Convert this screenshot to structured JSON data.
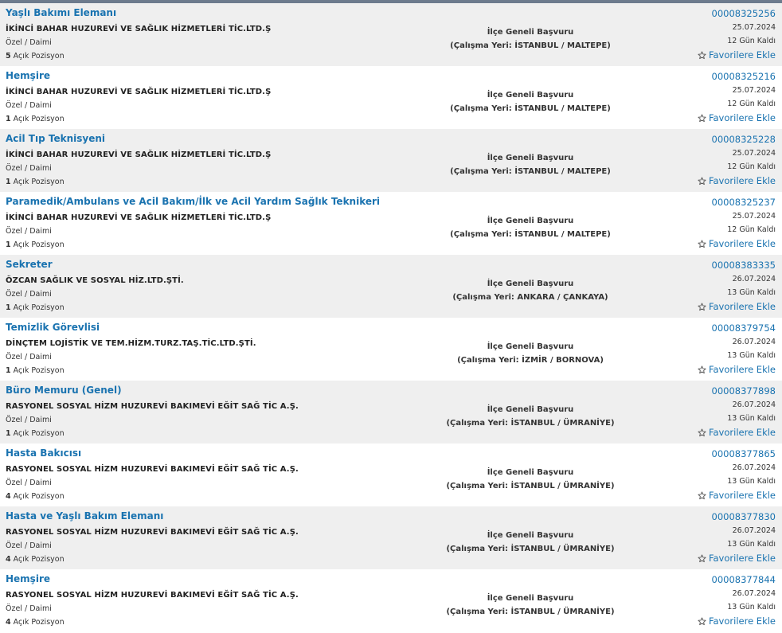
{
  "labels": {
    "open_positions_suffix": "Açık Pozisyon",
    "favorite": "Favorilere Ekle"
  },
  "icons": {
    "favorite": "star-outline-icon"
  },
  "colors": {
    "link": "#1a73b0",
    "row_alt_bg": "#efefef",
    "top_border": "#6d7b8d"
  },
  "jobs": [
    {
      "title": "Yaşlı Bakımı Elemanı",
      "company": "İKİNCİ BAHAR HUZUREVİ VE SAĞLIK HİZMETLERİ TİC.LTD.Ş",
      "type": "Özel / Daimi",
      "positions": "5",
      "scope": "İlçe Geneli Başvuru",
      "location": "(Çalışma Yeri: İSTANBUL / MALTEPE)",
      "code": "00008325256",
      "date": "25.07.2024",
      "days_left": "12 Gün Kaldı"
    },
    {
      "title": "Hemşire",
      "company": "İKİNCİ BAHAR HUZUREVİ VE SAĞLIK HİZMETLERİ TİC.LTD.Ş",
      "type": "Özel / Daimi",
      "positions": "1",
      "scope": "İlçe Geneli Başvuru",
      "location": "(Çalışma Yeri: İSTANBUL / MALTEPE)",
      "code": "00008325216",
      "date": "25.07.2024",
      "days_left": "12 Gün Kaldı"
    },
    {
      "title": "Acil Tıp Teknisyeni",
      "company": "İKİNCİ BAHAR HUZUREVİ VE SAĞLIK HİZMETLERİ TİC.LTD.Ş",
      "type": "Özel / Daimi",
      "positions": "1",
      "scope": "İlçe Geneli Başvuru",
      "location": "(Çalışma Yeri: İSTANBUL / MALTEPE)",
      "code": "00008325228",
      "date": "25.07.2024",
      "days_left": "12 Gün Kaldı"
    },
    {
      "title": "Paramedik/Ambulans ve Acil Bakım/İlk ve Acil Yardım Sağlık Teknikeri",
      "company": "İKİNCİ BAHAR HUZUREVİ VE SAĞLIK HİZMETLERİ TİC.LTD.Ş",
      "type": "Özel / Daimi",
      "positions": "1",
      "scope": "İlçe Geneli Başvuru",
      "location": "(Çalışma Yeri: İSTANBUL / MALTEPE)",
      "code": "00008325237",
      "date": "25.07.2024",
      "days_left": "12 Gün Kaldı"
    },
    {
      "title": "Sekreter",
      "company": "ÖZCAN SAĞLIK VE SOSYAL HİZ.LTD.ŞTİ.",
      "type": "Özel / Daimi",
      "positions": "1",
      "scope": "İlçe Geneli Başvuru",
      "location": "(Çalışma Yeri: ANKARA / ÇANKAYA)",
      "code": "00008383335",
      "date": "26.07.2024",
      "days_left": "13 Gün Kaldı"
    },
    {
      "title": "Temizlik Görevlisi",
      "company": "DİNÇTEM LOJİSTİK VE TEM.HİZM.TURZ.TAŞ.TİC.LTD.ŞTİ.",
      "type": "Özel / Daimi",
      "positions": "1",
      "scope": "İlçe Geneli Başvuru",
      "location": "(Çalışma Yeri: İZMİR / BORNOVA)",
      "code": "00008379754",
      "date": "26.07.2024",
      "days_left": "13 Gün Kaldı"
    },
    {
      "title": "Büro Memuru (Genel)",
      "company": "RASYONEL SOSYAL HİZM HUZUREVİ BAKIMEVİ EĞİT SAĞ TİC A.Ş.",
      "type": "Özel / Daimi",
      "positions": "1",
      "scope": "İlçe Geneli Başvuru",
      "location": "(Çalışma Yeri: İSTANBUL / ÜMRANİYE)",
      "code": "00008377898",
      "date": "26.07.2024",
      "days_left": "13 Gün Kaldı"
    },
    {
      "title": "Hasta Bakıcısı",
      "company": "RASYONEL SOSYAL HİZM HUZUREVİ BAKIMEVİ EĞİT SAĞ TİC A.Ş.",
      "type": "Özel / Daimi",
      "positions": "4",
      "scope": "İlçe Geneli Başvuru",
      "location": "(Çalışma Yeri: İSTANBUL / ÜMRANİYE)",
      "code": "00008377865",
      "date": "26.07.2024",
      "days_left": "13 Gün Kaldı"
    },
    {
      "title": "Hasta ve Yaşlı Bakım Elemanı",
      "company": "RASYONEL SOSYAL HİZM HUZUREVİ BAKIMEVİ EĞİT SAĞ TİC A.Ş.",
      "type": "Özel / Daimi",
      "positions": "4",
      "scope": "İlçe Geneli Başvuru",
      "location": "(Çalışma Yeri: İSTANBUL / ÜMRANİYE)",
      "code": "00008377830",
      "date": "26.07.2024",
      "days_left": "13 Gün Kaldı"
    },
    {
      "title": "Hemşire",
      "company": "RASYONEL SOSYAL HİZM HUZUREVİ BAKIMEVİ EĞİT SAĞ TİC A.Ş.",
      "type": "Özel / Daimi",
      "positions": "4",
      "scope": "İlçe Geneli Başvuru",
      "location": "(Çalışma Yeri: İSTANBUL / ÜMRANİYE)",
      "code": "00008377844",
      "date": "26.07.2024",
      "days_left": "13 Gün Kaldı"
    }
  ]
}
